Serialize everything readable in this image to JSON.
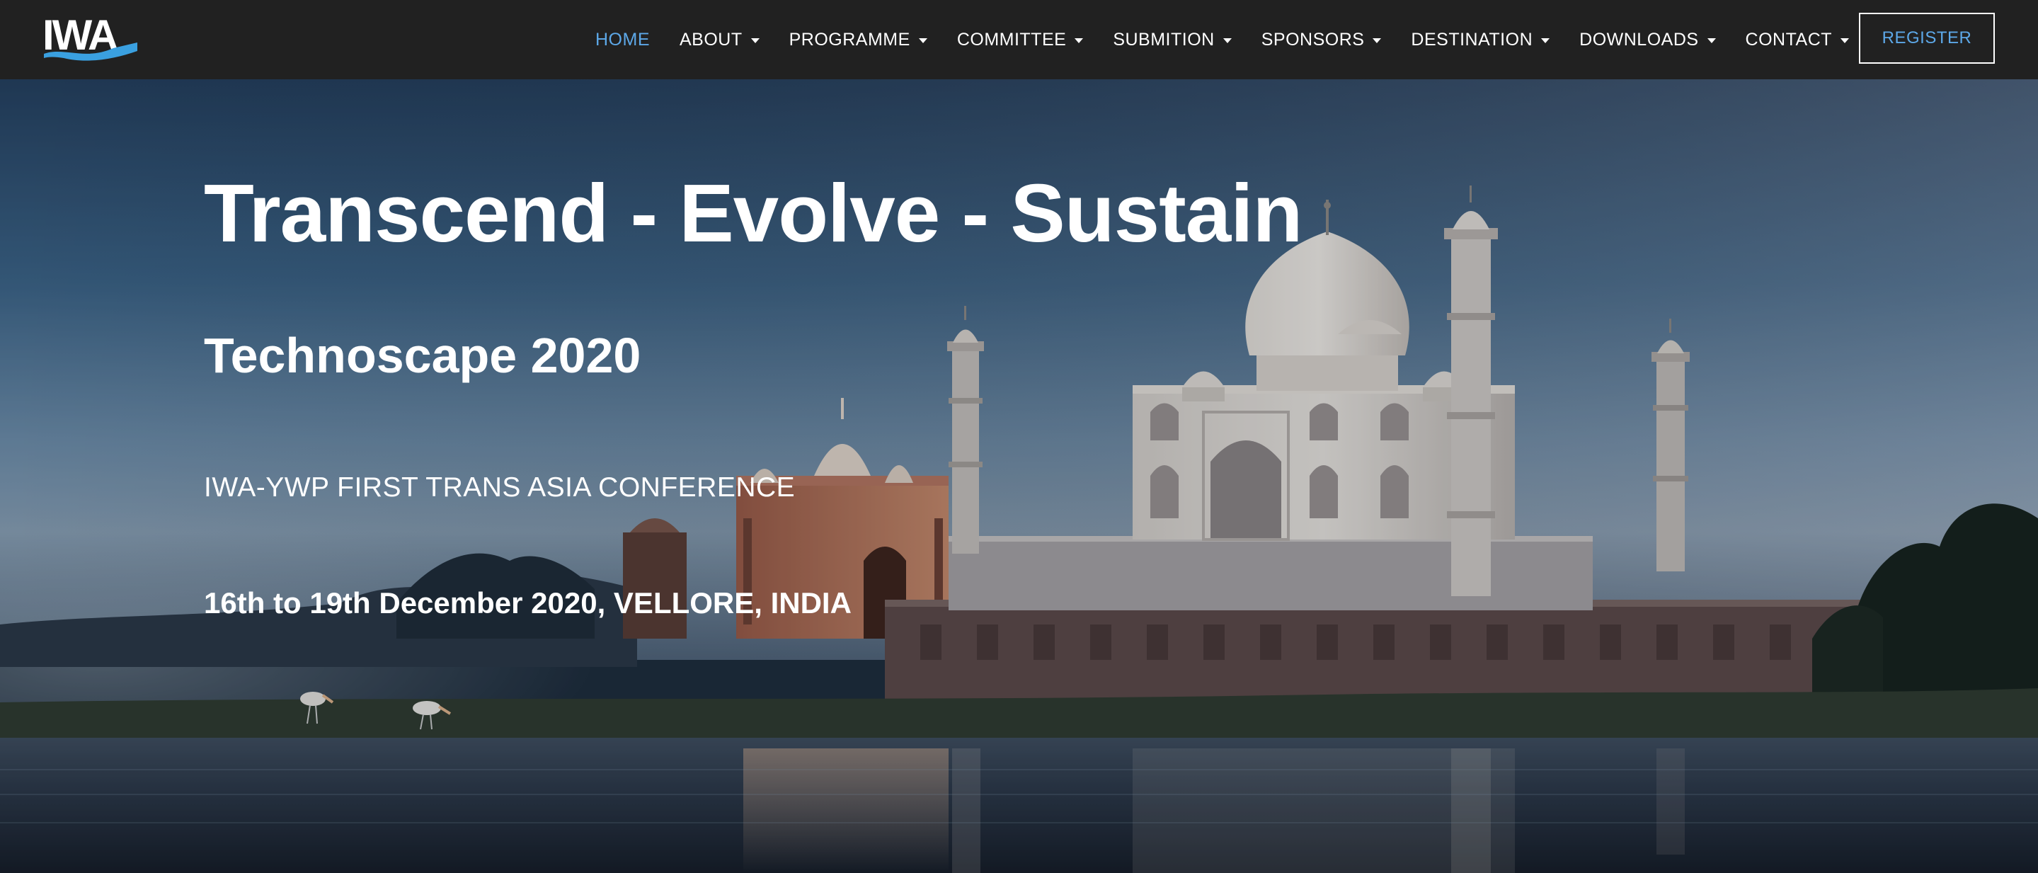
{
  "brand": {
    "logo_text": "IWA",
    "accent": "#3aa0e0"
  },
  "nav": {
    "items": [
      {
        "label": "HOME",
        "active": true,
        "dropdown": false
      },
      {
        "label": "ABOUT",
        "active": false,
        "dropdown": true
      },
      {
        "label": "PROGRAMME",
        "active": false,
        "dropdown": true
      },
      {
        "label": "COMMITTEE",
        "active": false,
        "dropdown": true
      },
      {
        "label": "SUBMITION",
        "active": false,
        "dropdown": true
      },
      {
        "label": "SPONSORS",
        "active": false,
        "dropdown": true
      },
      {
        "label": "DESTINATION",
        "active": false,
        "dropdown": true
      },
      {
        "label": "DOWNLOADS",
        "active": false,
        "dropdown": true
      },
      {
        "label": "CONTACT",
        "active": false,
        "dropdown": true
      }
    ],
    "register_label": "REGISTER",
    "active_color": "#5da8e8",
    "background": "#212121"
  },
  "hero": {
    "title": "Transcend - Evolve - Sustain",
    "subtitle": "Technoscape 2020",
    "conference": "IWA-YWP FIRST TRANS ASIA CONFERENCE",
    "date_location": "16th to 19th December 2020, VELLORE, INDIA",
    "background_image": "taj-mahal-river-dusk-photo"
  }
}
